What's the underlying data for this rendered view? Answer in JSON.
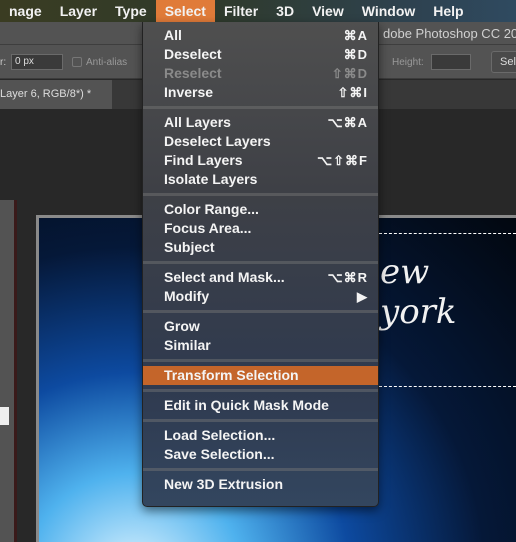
{
  "menubar": {
    "items": [
      "nage",
      "Layer",
      "Type",
      "Select",
      "Filter",
      "3D",
      "View",
      "Window",
      "Help"
    ],
    "active": "Select"
  },
  "app_title": "dobe Photoshop CC 20",
  "options": {
    "feather_label": "r:",
    "feather_value": "0 px",
    "antialias_label": "Anti-alias",
    "height_label": "Height:",
    "select_button": "Sel"
  },
  "document_tab": "Layer 6, RGB/8*) *",
  "canvas_text": "ew york",
  "accent_color": "#e07b39",
  "highlight_color": "#c4652a",
  "select_menu": {
    "groups": [
      [
        {
          "label": "All",
          "shortcut": "⌘A"
        },
        {
          "label": "Deselect",
          "shortcut": "⌘D"
        },
        {
          "label": "Reselect",
          "shortcut": "⇧⌘D",
          "disabled": true
        },
        {
          "label": "Inverse",
          "shortcut": "⇧⌘I"
        }
      ],
      [
        {
          "label": "All Layers",
          "shortcut": "⌥⌘A"
        },
        {
          "label": "Deselect Layers",
          "shortcut": ""
        },
        {
          "label": "Find Layers",
          "shortcut": "⌥⇧⌘F"
        },
        {
          "label": "Isolate Layers",
          "shortcut": ""
        }
      ],
      [
        {
          "label": "Color Range...",
          "shortcut": ""
        },
        {
          "label": "Focus Area...",
          "shortcut": ""
        },
        {
          "label": "Subject",
          "shortcut": ""
        }
      ],
      [
        {
          "label": "Select and Mask...",
          "shortcut": "⌥⌘R"
        },
        {
          "label": "Modify",
          "shortcut": "▶"
        }
      ],
      [
        {
          "label": "Grow",
          "shortcut": ""
        },
        {
          "label": "Similar",
          "shortcut": ""
        }
      ],
      [
        {
          "label": "Transform Selection",
          "shortcut": "",
          "highlighted": true
        }
      ],
      [
        {
          "label": "Edit in Quick Mask Mode",
          "shortcut": ""
        }
      ],
      [
        {
          "label": "Load Selection...",
          "shortcut": ""
        },
        {
          "label": "Save Selection...",
          "shortcut": ""
        }
      ],
      [
        {
          "label": "New 3D Extrusion",
          "shortcut": ""
        }
      ]
    ]
  }
}
